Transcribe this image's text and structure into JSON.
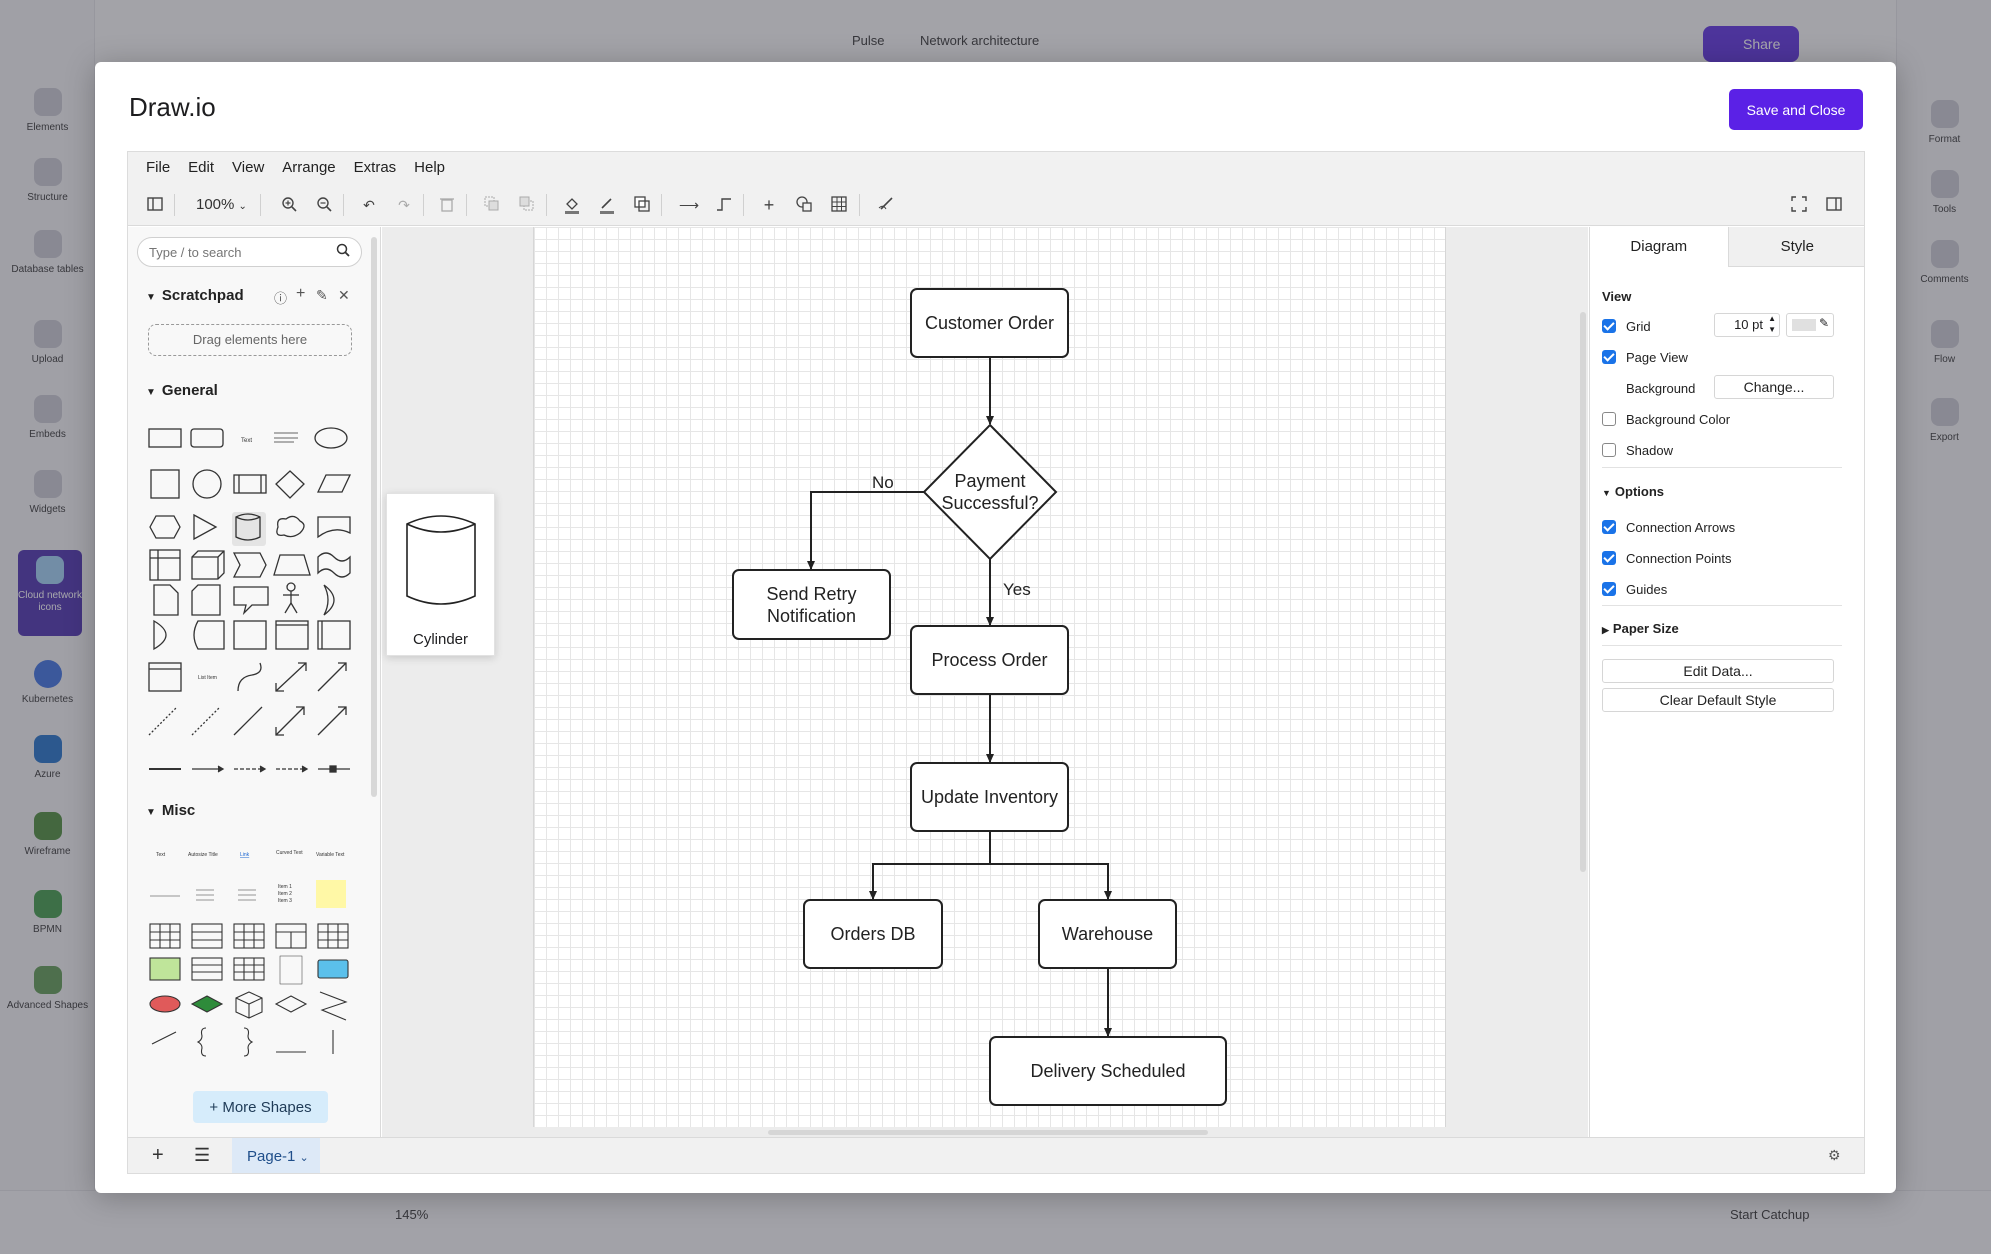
{
  "background_app": {
    "breadcrumb": [
      "Pulse",
      "Network architecture"
    ],
    "share_label": "Share",
    "zoom": "145%",
    "catchup_label": "Start Catchup",
    "left_nav": [
      "Elements",
      "Structure",
      "Database tables",
      "Upload",
      "Embeds",
      "Widgets",
      "Cloud network icons",
      "Kubernetes",
      "Azure",
      "Wireframe",
      "BPMN",
      "Advanced Shapes"
    ],
    "right_nav": [
      "Format",
      "Tools",
      "Comments",
      "Flow",
      "Export"
    ]
  },
  "modal": {
    "title": "Draw.io",
    "save_close_label": "Save and Close"
  },
  "menu": [
    "File",
    "Edit",
    "View",
    "Arrange",
    "Extras",
    "Help"
  ],
  "toolbar": {
    "zoom": "100%"
  },
  "sidebar": {
    "search_placeholder": "Type / to search",
    "scratchpad_title": "Scratchpad",
    "drag_hint": "Drag elements here",
    "general_title": "General",
    "misc_title": "Misc",
    "more_shapes_label": "+ More Shapes"
  },
  "tooltip": {
    "label": "Cylinder"
  },
  "diagram": {
    "nodes": {
      "customer_order": "Customer Order",
      "payment": "Payment Successful?",
      "send_retry": "Send Retry Notification",
      "process_order": "Process Order",
      "update_inventory": "Update Inventory",
      "orders_db": "Orders DB",
      "warehouse": "Warehouse",
      "delivery": "Delivery Scheduled"
    },
    "edges": {
      "no": "No",
      "yes": "Yes"
    }
  },
  "right_panel": {
    "tabs": [
      "Diagram",
      "Style"
    ],
    "view_title": "View",
    "grid_label": "Grid",
    "grid_size": "10 pt",
    "page_view_label": "Page View",
    "background_label": "Background",
    "change_label": "Change...",
    "bg_color_label": "Background Color",
    "shadow_label": "Shadow",
    "options_title": "Options",
    "connection_arrows": "Connection Arrows",
    "connection_points": "Connection Points",
    "guides": "Guides",
    "paper_size_title": "Paper Size",
    "edit_data_label": "Edit Data...",
    "clear_style_label": "Clear Default Style"
  },
  "footer": {
    "page_name": "Page-1"
  }
}
